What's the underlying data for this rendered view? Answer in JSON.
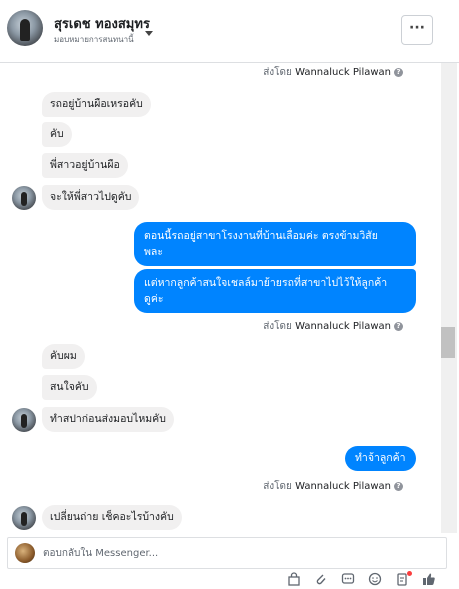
{
  "header": {
    "name": "สุรเดช ทองสมุทร",
    "subtitle": "มอบหมายการสนทนานี้",
    "more_label": "···"
  },
  "sent_by_prefix": "ส่งโดย",
  "sent_by_name": "Wannaluck Pilawan",
  "messages": {
    "m1": "รถอยู่บ้านผือเหรอคับ",
    "m2": "คับ",
    "m3": "พี่สาวอยู่บ้านผือ",
    "m4": "จะให้พี่สาวไปดูคับ",
    "o1_line1": "ตอนนี้รถอยู่สาขาโรงงานที่บ้านเลื่อมค่ะ ตรงข้ามวิสัย",
    "o1_line2": "พละ",
    "o2_line1": "แต่หากลูกค้าสนใจเชลล์มาย้ายรถที่สาขาไปไว้ให้ลูกค้า",
    "o2_line2": "ดูค่ะ",
    "m5": "คับผม",
    "m6": "สนใจคับ",
    "m7": "ทำสปาก่อนส่งมอบไหมคับ",
    "o3": "ทำจ้าลูกค้า",
    "m8": "เปลี่ยนถ่าย เช็คอะไรบ้างคับ"
  },
  "composer": {
    "placeholder": "ตอบกลับใน Messenger..."
  },
  "colors": {
    "outgoing": "#0084ff",
    "incoming": "#f1f0f0"
  }
}
